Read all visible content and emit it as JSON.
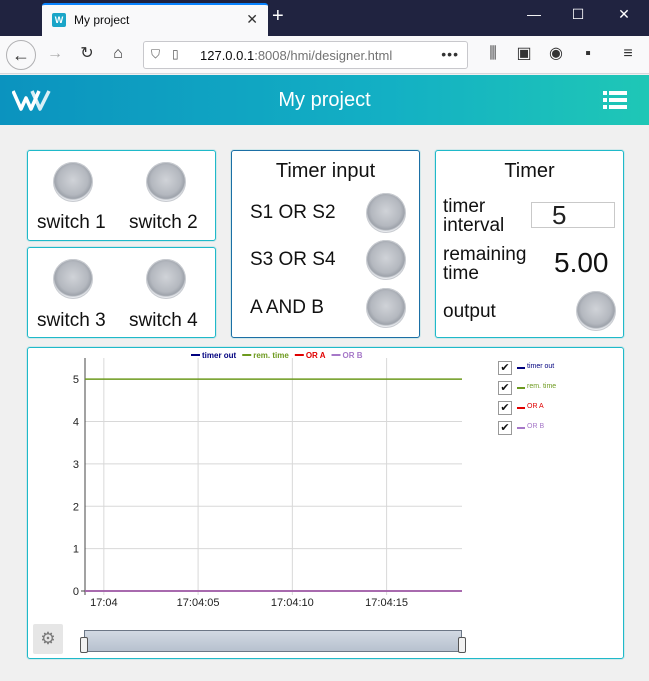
{
  "browser": {
    "tab_title": "My project",
    "tab_favicon": "W",
    "new_tab_icon": "+",
    "url_host": "127.0.0.1",
    "url_rest": ":8008/hmi/designer.html",
    "url_dots": "•••",
    "icons": [
      "back-icon",
      "forward-icon",
      "reload-icon",
      "home-icon",
      "shield-icon",
      "page-icon",
      "library-icon",
      "reader-icon",
      "account-icon",
      "extension-icon",
      "menu-icon"
    ]
  },
  "app": {
    "title": "My project",
    "logo_icon": "w-logo-icon",
    "menu_icon": "list-menu-icon",
    "accent": "#13b0c4"
  },
  "switches": {
    "items": [
      {
        "label": "switch 1"
      },
      {
        "label": "switch 2"
      },
      {
        "label": "switch 3"
      },
      {
        "label": "switch 4"
      }
    ]
  },
  "timer_input": {
    "title": "Timer input",
    "rows": [
      {
        "label": "S1 OR S2"
      },
      {
        "label": "S3 OR S4"
      },
      {
        "label": "A AND B"
      }
    ]
  },
  "timer": {
    "title": "Timer",
    "interval_label_1": "timer",
    "interval_label_2": "interval",
    "interval_value": "5",
    "remaining_label_1": "remaining",
    "remaining_label_2": "time",
    "remaining_value": "5.00",
    "output_label": "output"
  },
  "chart_data": {
    "type": "line",
    "xlabel": "",
    "ylabel": "",
    "x_ticks": [
      "17:04",
      "17:04:05",
      "17:04:10",
      "17:04:15"
    ],
    "x_seconds": [
      0,
      5,
      10,
      15
    ],
    "xlim": [
      -1,
      19
    ],
    "ylim": [
      0,
      5.5
    ],
    "y_ticks": [
      0,
      1,
      2,
      3,
      4,
      5
    ],
    "grid": true,
    "legend_top": "top",
    "series": [
      {
        "name": "timer out",
        "color": "#00007f",
        "x": [
          -1,
          19
        ],
        "values": [
          0,
          0
        ]
      },
      {
        "name": "rem. time",
        "color": "#6d9a1e",
        "x": [
          -1,
          19
        ],
        "values": [
          5,
          5
        ]
      },
      {
        "name": "OR A",
        "color": "#e00000",
        "x": [
          -1,
          19
        ],
        "values": [
          0,
          0
        ]
      },
      {
        "name": "OR B",
        "color": "#a678c8",
        "x": [
          -1,
          19
        ],
        "values": [
          0,
          0
        ]
      }
    ],
    "checkbox_mark": "✔",
    "settings_icon": "gear-icon"
  }
}
